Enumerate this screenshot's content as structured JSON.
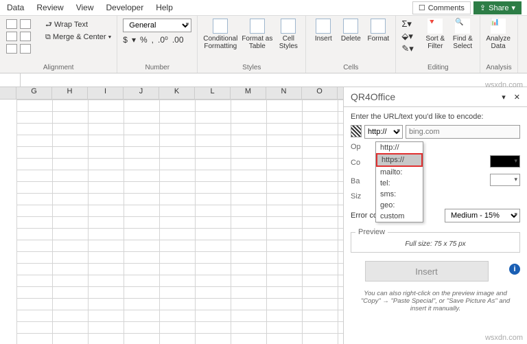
{
  "menu": {
    "data": "Data",
    "review": "Review",
    "view": "View",
    "developer": "Developer",
    "help": "Help"
  },
  "top": {
    "comments": "Comments",
    "share": "Share"
  },
  "ribbon": {
    "alignment": {
      "wrap": "Wrap Text",
      "merge": "Merge & Center",
      "label": "Alignment"
    },
    "number": {
      "format": "General",
      "label": "Number",
      "pct": "%",
      "comma": ",",
      "$": "$"
    },
    "styles": {
      "cond": "Conditional\nFormatting",
      "table": "Format as\nTable",
      "cell": "Cell\nStyles",
      "label": "Styles"
    },
    "cells": {
      "insert": "Insert",
      "delete": "Delete",
      "format": "Format",
      "label": "Cells"
    },
    "editing": {
      "sort": "Sort &\nFilter",
      "find": "Find &\nSelect",
      "label": "Editing"
    },
    "analysis": {
      "analyze": "Analyze\nData",
      "label": "Analysis"
    }
  },
  "cols": [
    "G",
    "H",
    "I",
    "J",
    "K",
    "L",
    "M",
    "N",
    "O"
  ],
  "pane": {
    "title": "QR4Office",
    "prompt": "Enter the URL/text you'd like to encode:",
    "proto_sel": "http://",
    "url_placeholder": "bing.com",
    "options": [
      "http://",
      "https://",
      "mailto:",
      "tel:",
      "sms:",
      "geo:",
      "custom"
    ],
    "opt_label": "Op",
    "color_label": "Co",
    "bg_label": "Ba",
    "size_label": "Siz",
    "error_label": "Error correction:",
    "error_val": "Medium - 15%",
    "preview_legend": "Preview",
    "preview_size": "Full size: 75 x 75 px",
    "insert": "Insert",
    "note": "You can also right-click on the preview image and \"Copy\" → \"Paste Special\", or \"Save Picture As\" and insert it manually."
  },
  "watermark": "wsxdn.com"
}
